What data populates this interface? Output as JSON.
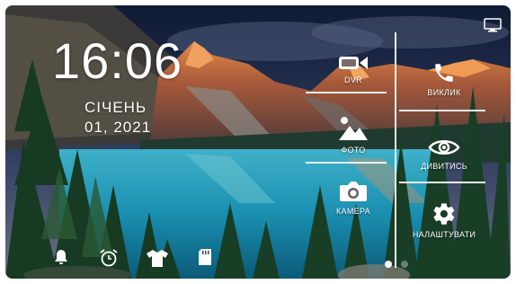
{
  "clock": {
    "time": "16:06"
  },
  "date": {
    "month": "СІЧЕНЬ",
    "day_year": "01, 2021"
  },
  "tiles": {
    "dvr": {
      "label": "DVR",
      "icon": "video-camera-icon"
    },
    "call": {
      "label": "ВИКЛИК",
      "icon": "phone-icon"
    },
    "photo": {
      "label": "ФОТО",
      "icon": "mountain-photo-icon"
    },
    "view": {
      "label": "ДИВИТИСЬ",
      "icon": "eye-icon"
    },
    "camera": {
      "label": "КАМЕРА",
      "icon": "camera-icon"
    },
    "settings": {
      "label": "НАЛАШТУВАТИ",
      "icon": "gear-icon"
    }
  },
  "bottom_bar": [
    "bell-icon",
    "alarm-clock-icon",
    "shirt-icon",
    "sd-card-icon"
  ],
  "status": {
    "monitor_icon": "monitor-icon"
  },
  "pager": {
    "active_page": 1,
    "pages": 2
  },
  "colors": {
    "accent": "#ffffff",
    "sky": "#1c2a4a",
    "lake": "#1a8fb0",
    "mountain_glow": "#e07a3a"
  }
}
